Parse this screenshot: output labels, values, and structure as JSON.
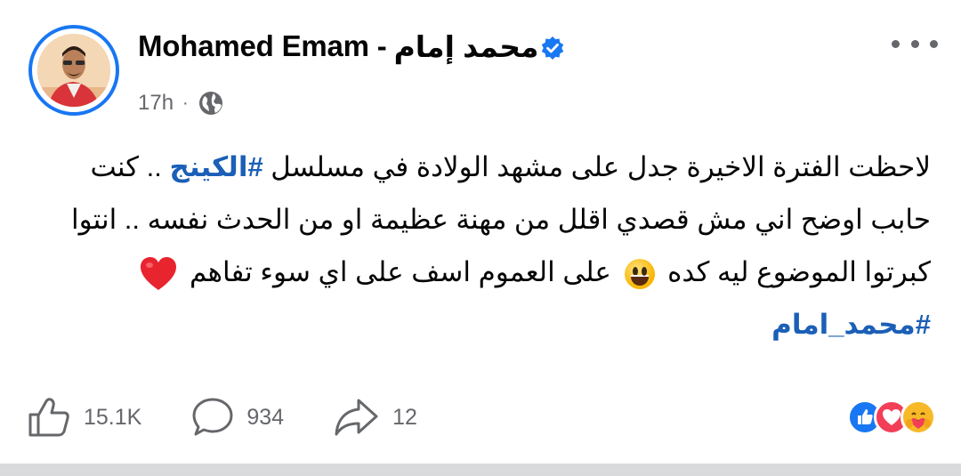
{
  "post": {
    "author_name_en": "Mohamed Emam -",
    "author_name_ar": "محمد إمام",
    "time": "17h",
    "separator": "·",
    "audience_icon": "globe-icon",
    "verified_icon": "verified-badge-icon",
    "more_icon": "more-options-icon",
    "text": {
      "line1_pre": "لاحظت الفترة الاخيرة جدل على مشهد الولادة في مسلسل ",
      "line1_hashtag": "#الكينج",
      "line1_post": " .. كنت",
      "line2": "حابب اوضح اني مش قصدي اقلل من مهنة عظيمة او من الحدث نفسه .. انتوا",
      "line3_pre": "كبرتوا الموضوع ليه كده ",
      "line3_mid": " على العموم اسف على اي سوء تفاهم ",
      "emoji_smile": "grinning-face-emoji",
      "emoji_heart": "red-heart-emoji"
    },
    "hashtag2": "#محمد_امام"
  },
  "actions": {
    "likes": "15.1K",
    "comments": "934",
    "shares": "12"
  },
  "reactions": [
    "like-reaction",
    "love-reaction",
    "care-reaction"
  ],
  "colors": {
    "accent": "#1877f2",
    "hashtag": "#1b5fb7",
    "secondary_text": "#65676b",
    "love": "#f33e58"
  }
}
